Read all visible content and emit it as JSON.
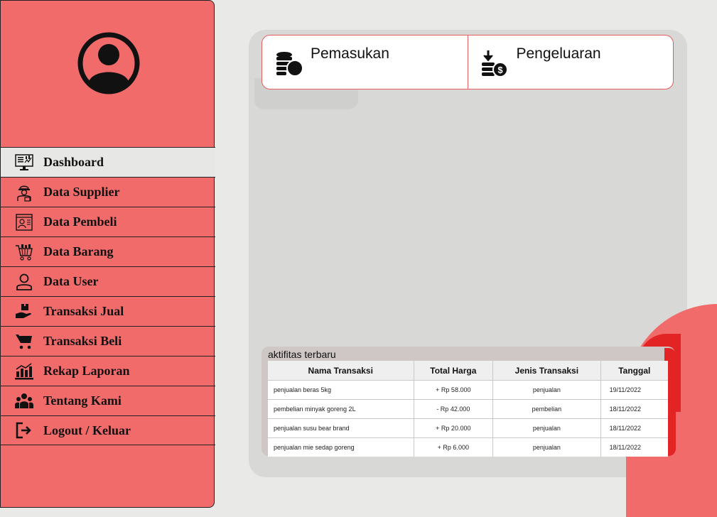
{
  "sidebar": {
    "items": [
      {
        "label": "Dashboard",
        "icon": "dashboard-monitor-icon",
        "active": true
      },
      {
        "label": "Data Supplier",
        "icon": "supplier-worker-icon"
      },
      {
        "label": "Data Pembeli",
        "icon": "buyer-profile-icon"
      },
      {
        "label": "Data Barang",
        "icon": "shopping-basket-icon"
      },
      {
        "label": "Data User",
        "icon": "user-outline-icon"
      },
      {
        "label": "Transaksi Jual",
        "icon": "hand-box-icon"
      },
      {
        "label": "Transaksi Beli",
        "icon": "cart-icon"
      },
      {
        "label": "Rekap Laporan",
        "icon": "report-chart-icon"
      },
      {
        "label": "Tentang Kami",
        "icon": "team-icon"
      },
      {
        "label": "Logout / Keluar",
        "icon": "logout-icon"
      }
    ]
  },
  "cards": {
    "income": {
      "title": "Pemasukan",
      "icon": "coins-icon"
    },
    "expense": {
      "title": "Pengeluaran",
      "icon": "coin-download-icon"
    }
  },
  "activity": {
    "title": "aktifitas terbaru",
    "columns": [
      "Nama Transaksi",
      "Total Harga",
      "Jenis Transaksi",
      "Tanggal"
    ],
    "rows": [
      [
        "penjualan beras 5kg",
        "+ Rp 58.000",
        "penjualan",
        "19/11/2022"
      ],
      [
        "pembelian minyak goreng 2L",
        "- Rp 42.000",
        "pembelian",
        "18/11/2022"
      ],
      [
        "penjualan susu bear brand",
        "+ Rp 20.000",
        "penjualan",
        "18/11/2022"
      ],
      [
        "penjualan mie sedap goreng",
        "+ Rp 6.000",
        "penjualan",
        "18/11/2022"
      ]
    ]
  },
  "colors": {
    "sidebar": "#f26b6b",
    "accent_red": "#e32424",
    "panel": "#d8d8d6"
  }
}
